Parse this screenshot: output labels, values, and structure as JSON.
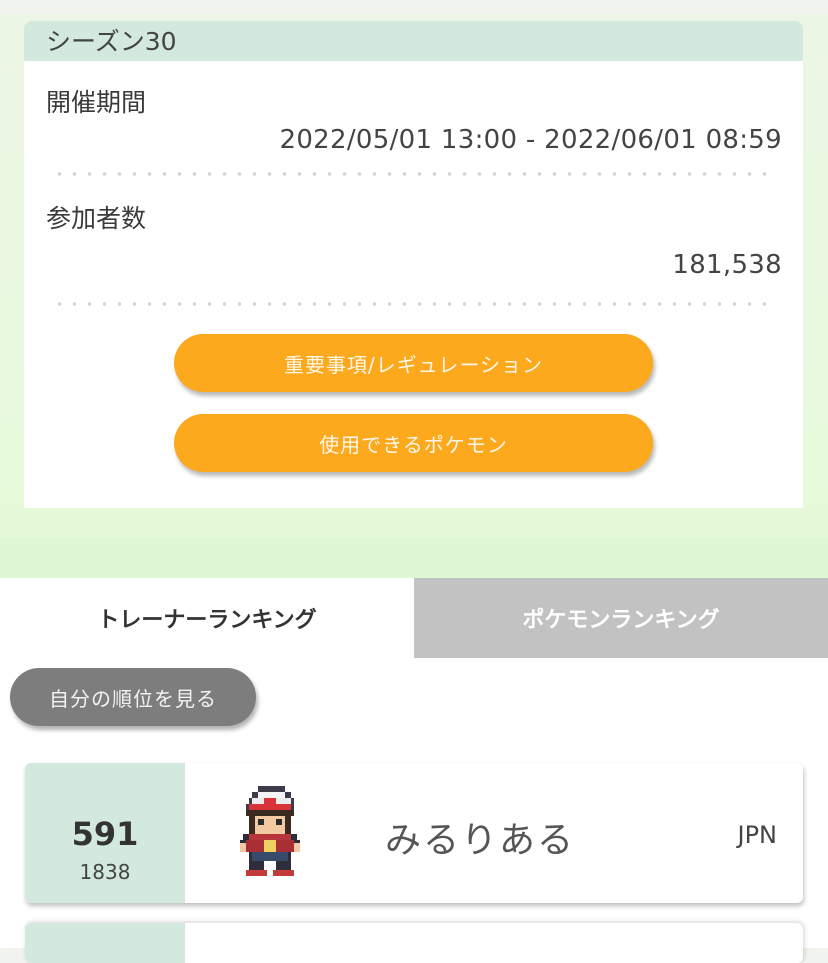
{
  "season": {
    "title": "シーズン30",
    "period_label": "開催期間",
    "period_value": "2022/05/01 13:00 - 2022/06/01 08:59",
    "participants_label": "参加者数",
    "participants_value": "181,538",
    "important_button": "重要事項/レギュレーション",
    "pokemon_button": "使用できるポケモン"
  },
  "tabs": {
    "trainer": "トレーナーランキング",
    "pokemon": "ポケモンランキング",
    "active": "trainer"
  },
  "my_rank_button": "自分の順位を見る",
  "rankings": [
    {
      "rank": "591",
      "rating": "1838",
      "name": "みるりある",
      "country": "JPN",
      "avatar_icon": "trainer-sprite-icon"
    }
  ],
  "colors": {
    "accent_orange": "#fca91e",
    "header_green": "#d3e9dd",
    "inactive_tab": "#c2c2c2"
  }
}
